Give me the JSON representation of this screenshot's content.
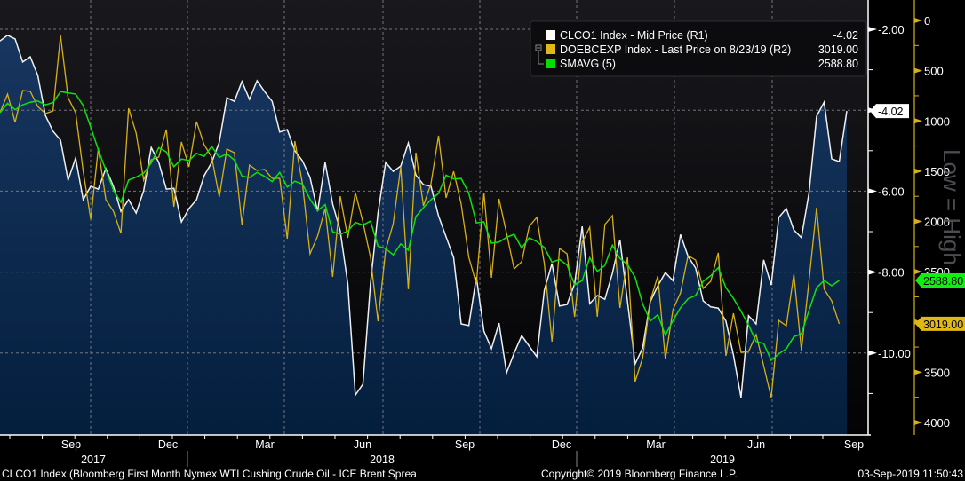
{
  "chart_data": {
    "type": "line",
    "start_week": "2017-06-23",
    "frequency": "weekly",
    "series": [
      {
        "name": "CLCO1 Index - Mid Price (R1)",
        "axis": "left",
        "color": "#ffffff",
        "fill": true,
        "last_value": "-4.02",
        "values": [
          -2.29,
          -2.15,
          -2.24,
          -2.81,
          -2.68,
          -3.14,
          -4.13,
          -4.52,
          -4.74,
          -5.73,
          -5.18,
          -6.21,
          -5.88,
          -5.95,
          -5.44,
          -5.88,
          -6.5,
          -6.21,
          -6.54,
          -5.99,
          -4.92,
          -5.29,
          -5.95,
          -5.93,
          -6.76,
          -6.43,
          -6.21,
          -5.62,
          -5.29,
          -4.79,
          -3.69,
          -3.78,
          -3.29,
          -3.73,
          -3.27,
          -3.54,
          -3.78,
          -4.54,
          -4.48,
          -5.0,
          -5.25,
          -5.66,
          -6.5,
          -5.29,
          -6.32,
          -6.98,
          -8.29,
          -11.04,
          -10.77,
          -8.29,
          -6.54,
          -5.29,
          -5.51,
          -5.38,
          -4.81,
          -5.6,
          -5.84,
          -5.88,
          -6.61,
          -7.13,
          -7.64,
          -9.28,
          -9.32,
          -8.12,
          -9.46,
          -9.89,
          -9.26,
          -10.49,
          -10.0,
          -9.57,
          -9.83,
          -10.09,
          -8.45,
          -7.79,
          -8.84,
          -8.8,
          -8.29,
          -6.87,
          -8.78,
          -8.58,
          -8.67,
          -8.03,
          -7.2,
          -8.73,
          -10.27,
          -9.87,
          -8.73,
          -8.34,
          -8.01,
          -8.21,
          -7.07,
          -7.61,
          -7.9,
          -8.71,
          -8.86,
          -8.89,
          -9.21,
          -10.05,
          -11.1,
          -9.08,
          -9.28,
          -7.7,
          -8.32,
          -6.65,
          -6.43,
          -6.96,
          -7.15,
          -6.04,
          -4.15,
          -3.8,
          -5.2,
          -5.27,
          -4.02
        ]
      },
      {
        "name": "DOEBCEXP Index - Last Price on 8/23/19 (R2)",
        "axis": "right",
        "color": "#e0b818",
        "last_value": "3019.00",
        "values": [
          918,
          733,
          1015,
          698,
          706,
          857,
          927,
          901,
          150,
          768,
          918,
          1501,
          1978,
          1272,
          1784,
          1898,
          2119,
          874,
          1121,
          1589,
          1386,
          1360,
          1086,
          1854,
          1210,
          1457,
          1007,
          1236,
          1360,
          1757,
          1280,
          1316,
          2031,
          1439,
          1492,
          1483,
          1572,
          1572,
          2172,
          1201,
          1625,
          2322,
          2146,
          1872,
          2552,
          1748,
          2163,
          1713,
          2004,
          2358,
          2993,
          2287,
          2022,
          1457,
          2675,
          1316,
          1845,
          1625,
          1148,
          1766,
          1501,
          1828,
          2358,
          2623,
          1713,
          2561,
          1775,
          2119,
          2472,
          2402,
          2049,
          1960,
          2419,
          3196,
          2269,
          2322,
          2949,
          2208,
          2057,
          2949,
          2031,
          1943,
          2861,
          2358,
          3594,
          3355,
          2790,
          2543,
          3373,
          2879,
          2711,
          2340,
          2384,
          2667,
          2596,
          2313,
          3338,
          2914,
          3302,
          3294,
          3126,
          3435,
          3753,
          2985,
          3038,
          2525,
          3285,
          2587,
          1863,
          2675,
          2790,
          3019
        ]
      },
      {
        "name": "SMAVG (5)",
        "axis": "right",
        "color": "#00e000",
        "period": 5,
        "source": "DOEBCEXP",
        "last_value": "2588.80"
      }
    ],
    "left_axis": {
      "ticks": [
        -2,
        -4,
        -6,
        -8,
        -10
      ],
      "labels": [
        "-2.00",
        "-4.00",
        "-6.00",
        "-8.00",
        "-10.00"
      ],
      "range": [
        -1.8,
        -11.5
      ]
    },
    "right_axis": {
      "ticks": [
        0,
        500,
        1000,
        1500,
        2000,
        2500,
        3000,
        3500,
        4000
      ],
      "labels": [
        "0",
        "500",
        "1000",
        "1500",
        "2000",
        "2500",
        "3000",
        "3500",
        "4000"
      ],
      "range": [
        0,
        4000
      ],
      "inverted": true,
      "side_label": "Low = High"
    },
    "x_axis": {
      "month_labels": [
        "Sep",
        "Dec",
        "Mar",
        "Jun",
        "Sep",
        "Dec",
        "Mar",
        "Jun",
        "Sep"
      ],
      "year_labels": [
        "2017",
        "2018",
        "2019"
      ]
    },
    "legend": [
      {
        "label": "CLCO1 Index - Mid Price (R1)",
        "value": "-4.02"
      },
      {
        "label": "DOEBCEXP Index - Last Price on 8/23/19 (R2)",
        "value": "3019.00"
      },
      {
        "label": "SMAVG (5)",
        "value": "2588.80"
      }
    ],
    "grid": true
  },
  "footer": {
    "description": "CLCO1 Index (Bloomberg First Month Nymex WTI Cushing Crude Oil - ICE Brent Sprea",
    "copyright": "Copyright© 2019 Bloomberg Finance L.P.",
    "timestamp": "03-Sep-2019 11:50:43"
  }
}
